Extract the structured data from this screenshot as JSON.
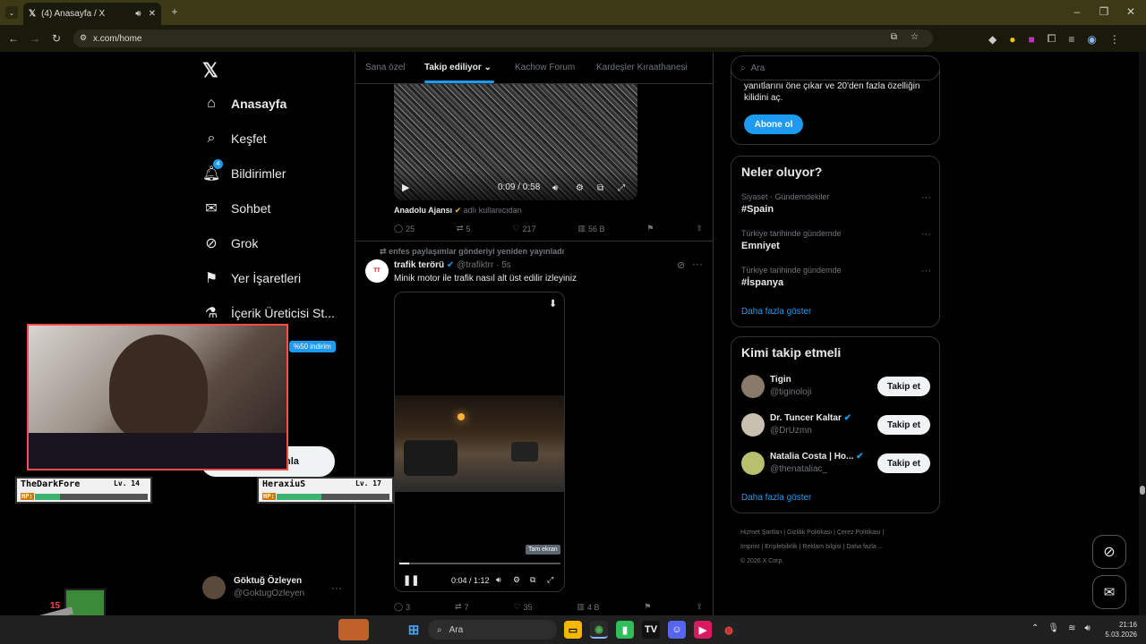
{
  "browser": {
    "tab_title": "(4) Anasayfa / X",
    "url": "x.com/home"
  },
  "feed_tabs": [
    "Sana özel",
    "Takip ediliyor",
    "Kachow Forum",
    "Kardeşler Kıraathanesi"
  ],
  "search": {
    "placeholder": "Ara"
  },
  "nav": [
    {
      "icon": "home-icon",
      "label": "Anasayfa"
    },
    {
      "icon": "search-icon",
      "label": "Keşfet"
    },
    {
      "icon": "bell-icon",
      "label": "Bildirimler",
      "badge": "4"
    },
    {
      "icon": "mail-icon",
      "label": "Sohbet"
    },
    {
      "icon": "grok-icon",
      "label": "Grok"
    },
    {
      "icon": "bookmark-icon",
      "label": "Yer İşaretleri"
    },
    {
      "icon": "flask-icon",
      "label": "İçerik Üreticisi St..."
    }
  ],
  "promo_badge": "%50 indirim",
  "post_button_partial": "nla",
  "account": {
    "name": "Göktuğ Özleyen",
    "handle": "@GoktugOzleyen"
  },
  "tweet1": {
    "video_time": "0:09 / 0:58",
    "author": "Anadolu Ajansı",
    "author_suffix": "adlı kullanıcıdan",
    "replies": "25",
    "reposts": "5",
    "likes": "217",
    "views": "56 B"
  },
  "tweet2": {
    "repost_note": "enfes paylaşımlar gönderiyi yeniden yayınladı",
    "author": "trafik terörü",
    "handle": "@trafiktrr",
    "time": "· 5s",
    "text": "Minik motor ile trafik nasıl alt üst edilir izleyiniz",
    "video_time": "0:04 / 1:12",
    "tooltip": "Tam ekran",
    "replies": "3",
    "reposts": "7",
    "likes": "35",
    "views": "4 B"
  },
  "premium": {
    "text_line1": "yanıtlarını öne çıkar ve 20'den fazla özelliğin",
    "text_line2": "kilidini aç.",
    "button": "Abone ol"
  },
  "trends": {
    "title": "Neler oluyor?",
    "items": [
      {
        "category": "Siyaset · Gündemdekiler",
        "name": "#Spain"
      },
      {
        "category": "Türkiye tarihinde gündemde",
        "name": "Emniyet"
      },
      {
        "category": "Türkiye tarihinde gündemde",
        "name": "#İspanya"
      }
    ],
    "more": "Daha fazla göster"
  },
  "who_to_follow": {
    "title": "Kimi takip etmeli",
    "items": [
      {
        "name": "Tigin",
        "handle": "@tiginoloji",
        "verified": false,
        "button": "Takip et"
      },
      {
        "name": "Dr. Tuncer Kaltar",
        "handle": "@DrUzmn",
        "verified": true,
        "button": "Takip et"
      },
      {
        "name": "Natalia Costa | Ho...",
        "handle": "@thenataliac_",
        "verified": true,
        "button": "Takip et"
      }
    ],
    "more": "Daha fazla göster"
  },
  "footer": [
    "Hizmet Şartları",
    "Gizlilik Politikası",
    "Çerez Politikası",
    "İmprint",
    "Erişilebilirlik",
    "Reklam bilgisi",
    "Daha fazla ...",
    "© 2026 X Corp."
  ],
  "overlay": {
    "player1": {
      "name": "TheDarkFore",
      "level": "Lv. 14",
      "hp": "HP:"
    },
    "player2": {
      "name": "HeraxiuS",
      "level": "Lv. 17",
      "hp": "HP:"
    },
    "level_badge": "15"
  },
  "taskbar": {
    "search": "Ara",
    "time": "21:16",
    "date": "5.03.2026"
  },
  "colors": {
    "accent": "#1d9bf0",
    "chrome": "#3c3a16",
    "hp_green": "#3cb371"
  }
}
